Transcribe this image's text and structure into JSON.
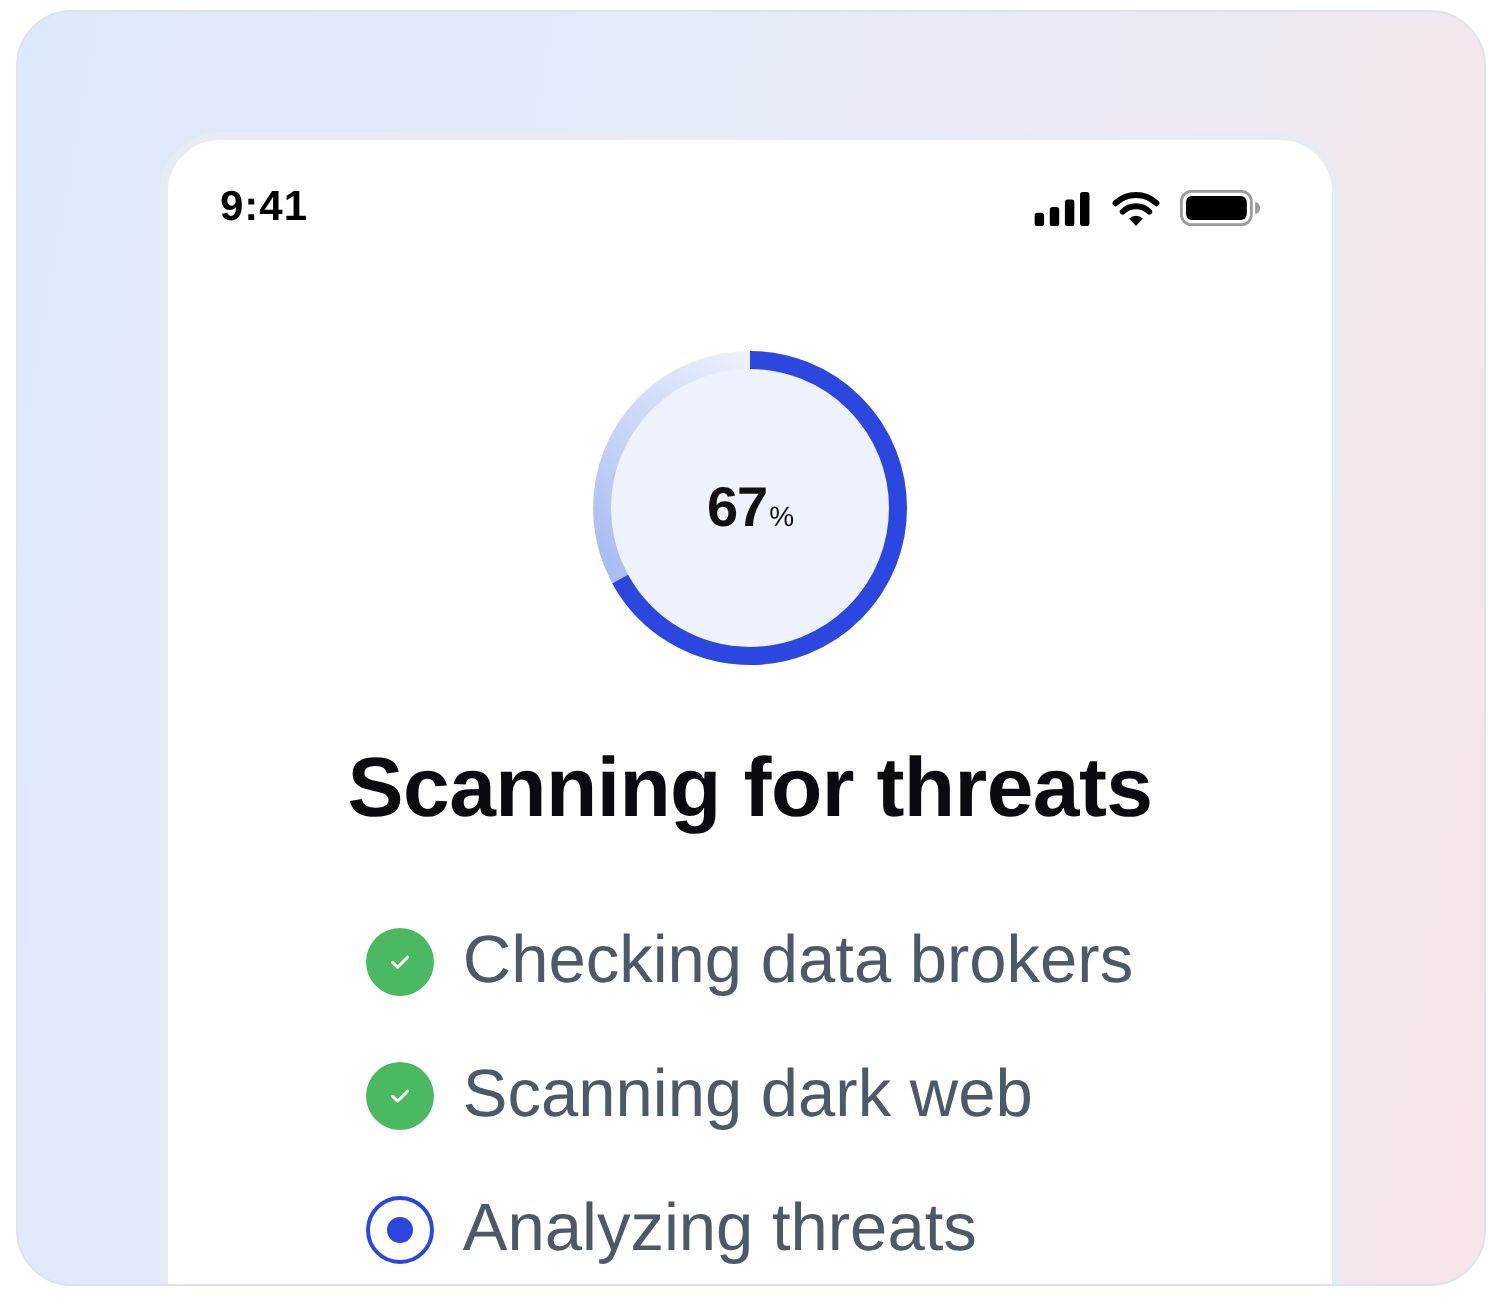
{
  "status_bar": {
    "time": "9:41"
  },
  "progress": {
    "level": 0.67,
    "value": "67",
    "unit": "%"
  },
  "title": "Scanning for threats",
  "steps": [
    {
      "label": "Checking data brokers",
      "kind": "done"
    },
    {
      "label": "Scanning dark web",
      "kind": "done"
    },
    {
      "label": "Analyzing threats",
      "kind": "active"
    }
  ]
}
